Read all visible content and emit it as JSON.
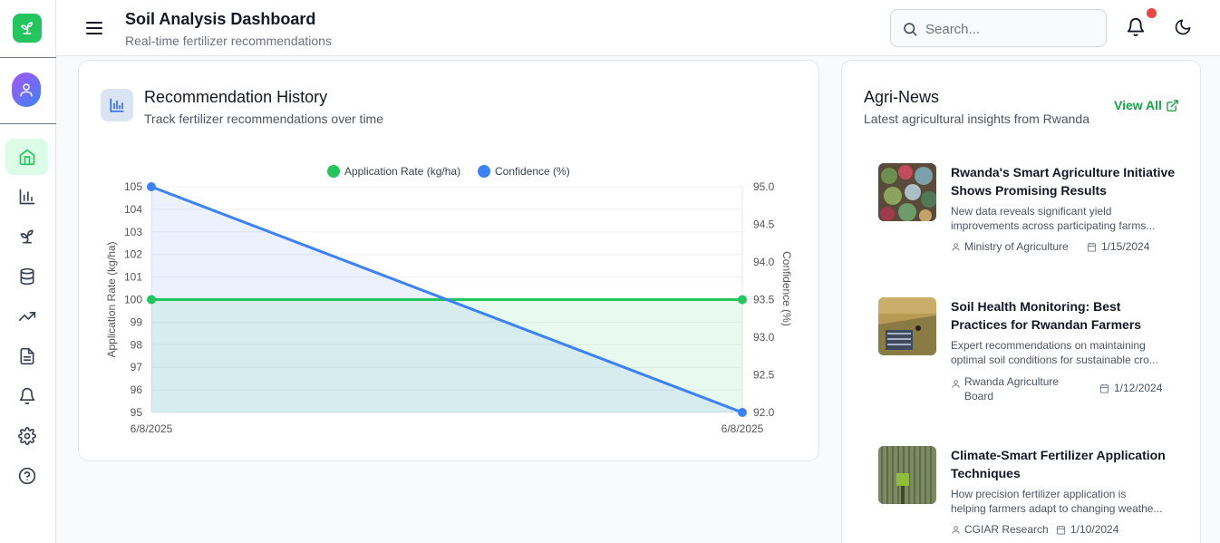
{
  "header": {
    "title": "Soil Analysis Dashboard",
    "subtitle": "Real-time fertilizer recommendations",
    "search_placeholder": "Search..."
  },
  "sidebar": {
    "items": [
      {
        "icon": "home-icon",
        "active": true
      },
      {
        "icon": "bar-chart-icon",
        "active": false
      },
      {
        "icon": "sprout-icon",
        "active": false
      },
      {
        "icon": "database-icon",
        "active": false
      },
      {
        "icon": "trending-up-icon",
        "active": false
      },
      {
        "icon": "file-text-icon",
        "active": false
      },
      {
        "icon": "bell-icon",
        "active": false
      },
      {
        "icon": "settings-icon",
        "active": false
      },
      {
        "icon": "help-icon",
        "active": false
      }
    ]
  },
  "history": {
    "title": "Recommendation History",
    "subtitle": "Track fertilizer recommendations over time"
  },
  "chart_data": {
    "type": "line",
    "x": [
      "6/8/2025",
      "6/8/2025"
    ],
    "series": [
      {
        "name": "Application Rate (kg/ha)",
        "axis": "left",
        "values": [
          100,
          100
        ],
        "color": "#22c55e"
      },
      {
        "name": "Confidence (%)",
        "axis": "right",
        "values": [
          95.0,
          92.0
        ],
        "color": "#3b82f6"
      }
    ],
    "ylabel": "Application Rate (kg/ha)",
    "ylabel_right": "Confidence (%)",
    "ylim": [
      95,
      105
    ],
    "ylim_right": [
      92.0,
      95.0
    ],
    "yticks": [
      "95",
      "96",
      "97",
      "98",
      "99",
      "100",
      "101",
      "102",
      "103",
      "104",
      "105"
    ],
    "yticks_right": [
      "92.0",
      "92.5",
      "93.0",
      "93.5",
      "94.0",
      "94.5",
      "95.0"
    ],
    "legend": "top",
    "grid": true
  },
  "news": {
    "title": "Agri-News",
    "subtitle": "Latest agricultural insights from Rwanda",
    "view_all": "View All",
    "items": [
      {
        "title": "Rwanda's Smart Agriculture Initiative Shows Promising Results",
        "desc_line1": "New data reveals significant yield",
        "desc_line2": "improvements across participating farms...",
        "source_line1": "Ministry of Agriculture",
        "source_line2": "",
        "date": "1/15/2024"
      },
      {
        "title": "Soil Health Monitoring: Best Practices for Rwandan Farmers",
        "desc_line1": "Expert recommendations on maintaining",
        "desc_line2": "optimal soil conditions for sustainable cro...",
        "source_line1": "Rwanda Agriculture",
        "source_line2": "Board",
        "date": "1/12/2024"
      },
      {
        "title": "Climate-Smart Fertilizer Application Techniques",
        "desc_line1": "How precision fertilizer application is",
        "desc_line2": "helping farmers adapt to changing weathe...",
        "source_line1": "CGIAR Research",
        "source_line2": "",
        "date": "1/10/2024"
      }
    ]
  },
  "colors": {
    "accent": "#22c55e",
    "blue": "#3b82f6",
    "notification": "#ef4444"
  }
}
